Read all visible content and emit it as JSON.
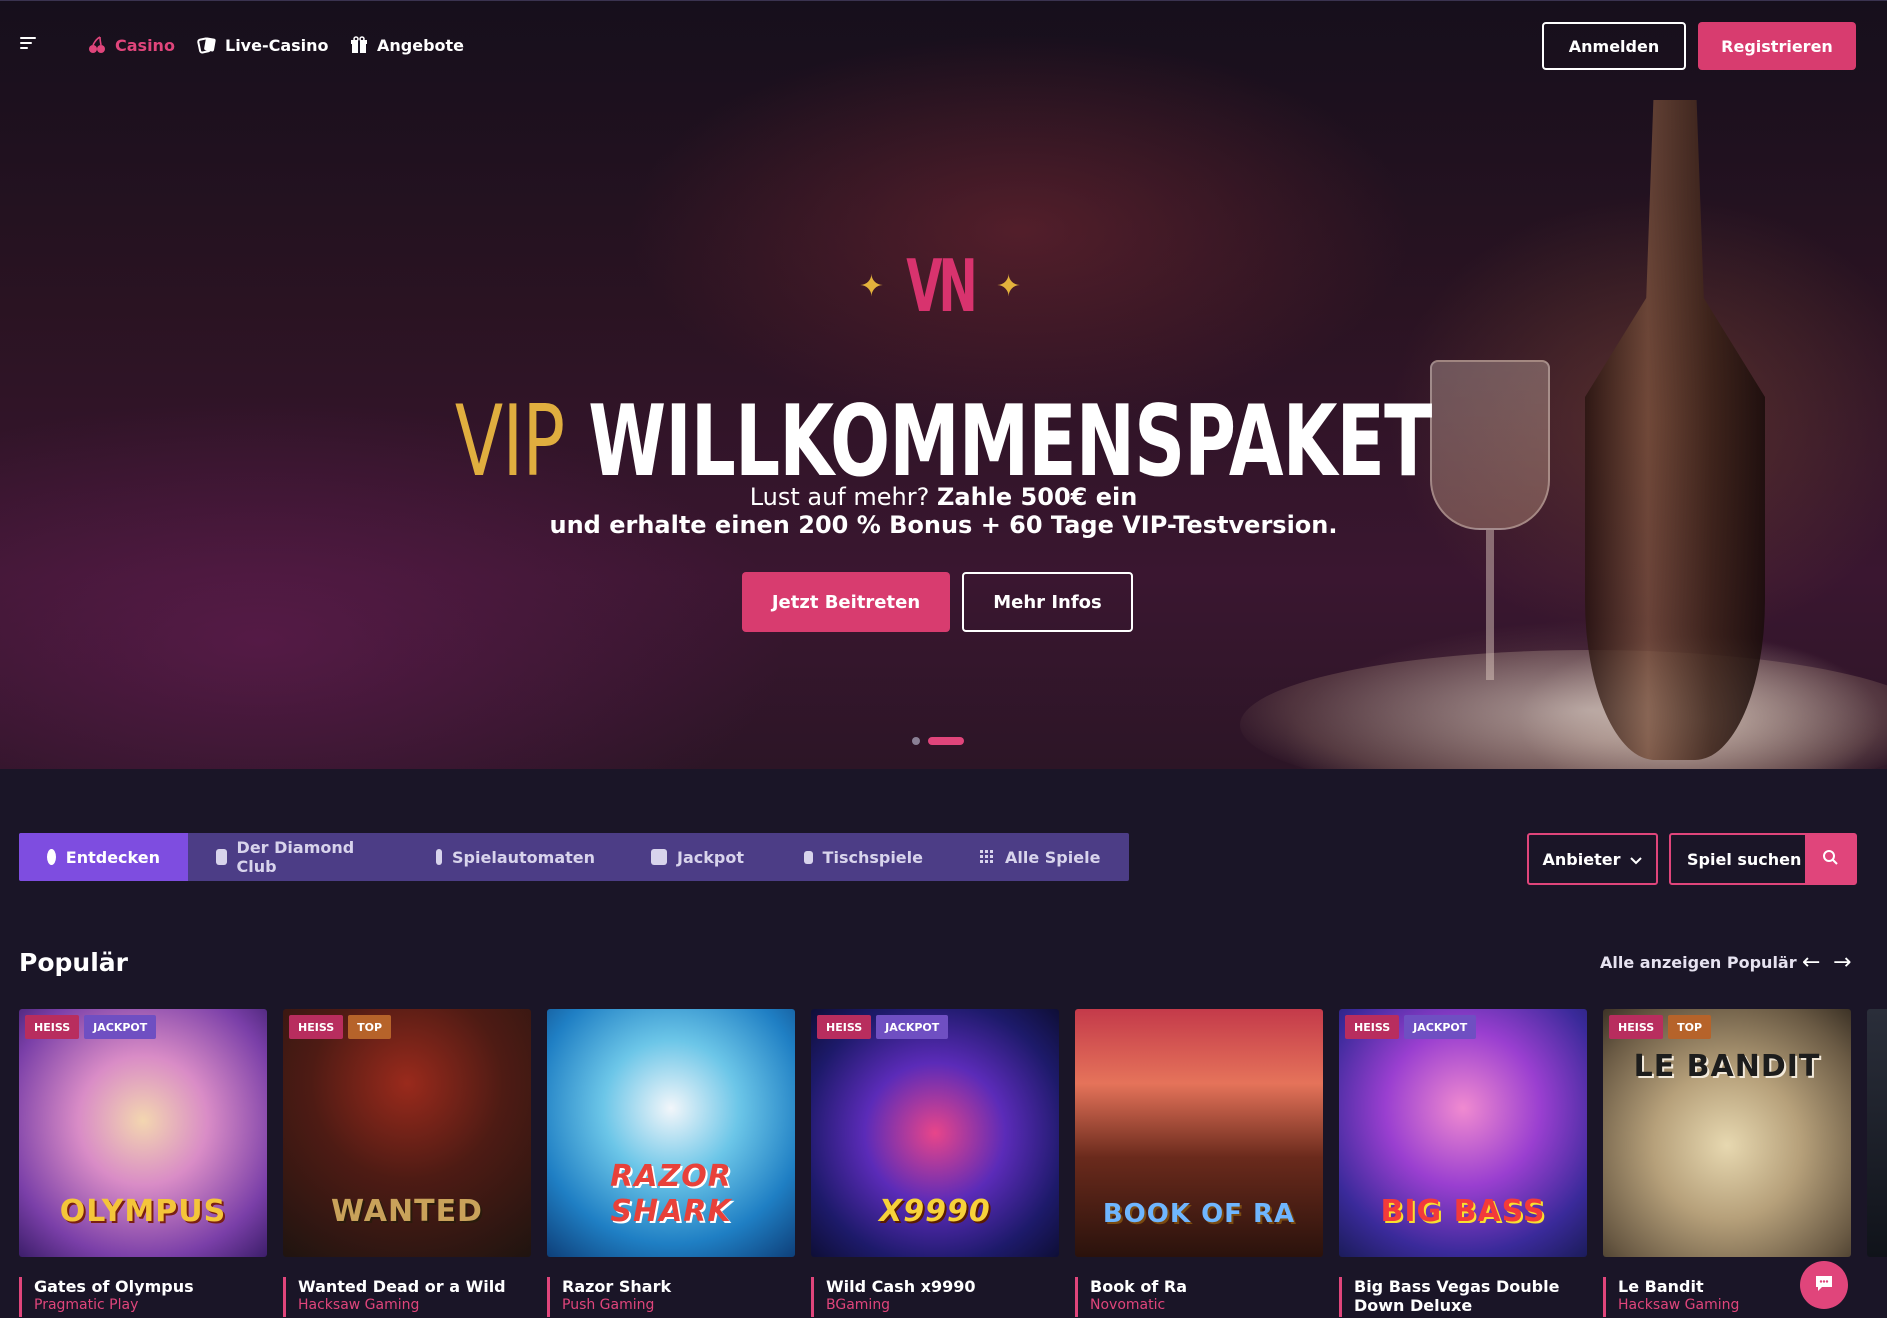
{
  "nav": {
    "links": [
      {
        "label": "Casino",
        "icon": "cherry-icon"
      },
      {
        "label": "Live-Casino",
        "icon": "cards-icon"
      },
      {
        "label": "Angebote",
        "icon": "gift-icon"
      }
    ],
    "login_label": "Anmelden",
    "register_label": "Registrieren"
  },
  "hero": {
    "logo_text": "VN",
    "title_gold": "VIP",
    "title_main": "WILLKOMMENSPAKET",
    "subtitle_line1_plain": "Lust auf mehr?",
    "subtitle_line1_bold": "Zahle 500€ ein",
    "subtitle_line2": "und erhalte einen 200 % Bonus + 60 Tage VIP-Testversion.",
    "join_label": "Jetzt Beitreten",
    "info_label": "Mehr Infos",
    "slides_total": 2,
    "active_slide": 2
  },
  "categories": [
    {
      "label": "Entdecken",
      "icon": "compass-icon",
      "active": true
    },
    {
      "label": "Der Diamond Club",
      "icon": "card-icon",
      "active": false
    },
    {
      "label": "Spielautomaten",
      "icon": "slot-machine-icon",
      "active": false
    },
    {
      "label": "Jackpot",
      "icon": "coins-icon",
      "active": false
    },
    {
      "label": "Tischspiele",
      "icon": "dice-icon",
      "active": false
    },
    {
      "label": "Alle Spiele",
      "icon": "grid-icon",
      "active": false
    }
  ],
  "filters": {
    "provider_label": "Anbieter",
    "search_label": "Spiel suchen"
  },
  "popular": {
    "title": "Populär",
    "see_all": "Alle anzeigen Populär",
    "games": [
      {
        "name": "Gates of Olympus",
        "provider": "Pragmatic Play",
        "badges": [
          "HEISS",
          "JACKPOT"
        ],
        "art": "OLYMPUS"
      },
      {
        "name": "Wanted Dead or a Wild",
        "provider": "Hacksaw Gaming",
        "badges": [
          "HEISS",
          "TOP"
        ],
        "art": "WANTED"
      },
      {
        "name": "Razor Shark",
        "provider": "Push Gaming",
        "badges": [],
        "art": "RAZOR SHARK"
      },
      {
        "name": "Wild Cash x9990",
        "provider": "BGaming",
        "badges": [
          "HEISS",
          "JACKPOT"
        ],
        "art": "X9990"
      },
      {
        "name": "Book of Ra",
        "provider": "Novomatic",
        "badges": [],
        "art": "BOOK OF RA"
      },
      {
        "name": "Big Bass Vegas Double Down Deluxe",
        "provider": "",
        "badges": [
          "HEISS",
          "JACKPOT"
        ],
        "art": "BIG BASS"
      },
      {
        "name": "Le Bandit",
        "provider": "Hacksaw Gaming",
        "badges": [
          "HEISS",
          "TOP"
        ],
        "art": "LE BANDIT"
      }
    ]
  },
  "colors": {
    "accent": "#e0457b",
    "gold": "#e0ae3f",
    "category_bar": "#4c3d86",
    "category_active": "#7e4de0",
    "background": "#1a1527"
  }
}
